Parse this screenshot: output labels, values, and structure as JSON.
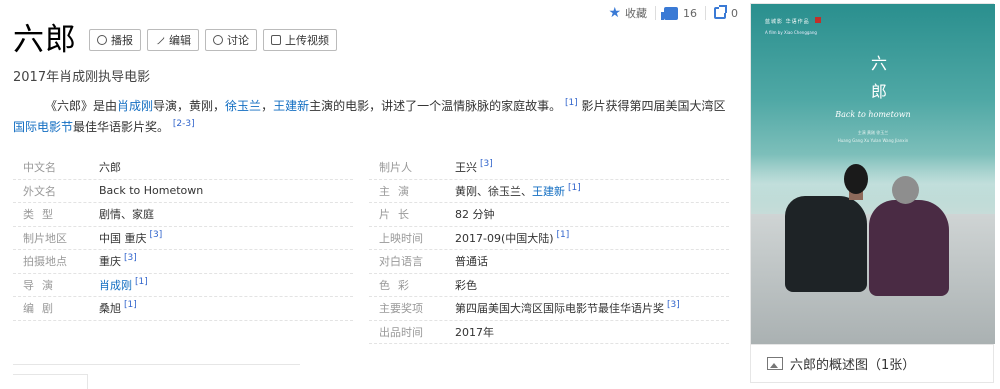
{
  "top_actions": {
    "favorite_label": "收藏",
    "like_count": "16",
    "share_count": "0"
  },
  "title": "六郎",
  "buttons": {
    "play": "播报",
    "edit": "编辑",
    "discuss": "讨论",
    "upload": "上传视频"
  },
  "subtitle": "2017年肖成刚执导电影",
  "description": {
    "p1": "《六郎》是由",
    "l1": "肖成刚",
    "p2": "导演，黄刚，",
    "l2": "徐玉兰",
    "p3": "，",
    "l3": "王建新",
    "p4": "主演的电影，讲述了一个温情脉脉的家庭故事。",
    "ref1": "[1]",
    "p5": "影片获得第四届美国大湾区",
    "l4": "国际电影节",
    "p6": "最佳华语影片奖。",
    "ref2": "[2-3]"
  },
  "info_left": [
    {
      "key": "中文名",
      "value": "六郎",
      "ref": ""
    },
    {
      "key": "外文名",
      "value": "Back to Hometown",
      "ref": ""
    },
    {
      "key": "类型",
      "value": "剧情、家庭",
      "ref": ""
    },
    {
      "key": "制片地区",
      "value": "中国 重庆",
      "ref": "[3]"
    },
    {
      "key": "拍摄地点",
      "value": "重庆",
      "ref": "[3]"
    },
    {
      "key": "导演",
      "value": "肖成刚",
      "ref": "[1]"
    },
    {
      "key": "编剧",
      "value": "桑旭",
      "ref": "[1]"
    }
  ],
  "info_right": [
    {
      "key": "制片人",
      "value": "王兴",
      "ref": "[3]"
    },
    {
      "key": "主演",
      "value_pre": "黄刚、徐玉兰、",
      "value_link": "王建新",
      "ref": "[1]"
    },
    {
      "key": "片长",
      "value": "82 分钟",
      "ref": ""
    },
    {
      "key": "上映时间",
      "value": "2017-09(中国大陆)",
      "ref": "[1]"
    },
    {
      "key": "对白语言",
      "value": "普通话",
      "ref": ""
    },
    {
      "key": "色彩",
      "value": "彩色",
      "ref": ""
    },
    {
      "key": "主要奖项",
      "value": "第四届美国大湾区国际电影节最佳华语片奖",
      "ref": "[3]"
    },
    {
      "key": "出品时间",
      "value": "2017年",
      "ref": ""
    }
  ],
  "poster": {
    "studio": "蓝城影 华语作品",
    "film_by": "A film by Xiao Chenggang",
    "title_line1": "六",
    "title_line2": "郎",
    "en_title": "Back to hometown",
    "credits_top": "主演 黄刚 徐玉兰",
    "credits_top2": "Huang Gang  Xu Yulan  Wang Jianxin",
    "caption": "六郎的概述图（1张）"
  }
}
